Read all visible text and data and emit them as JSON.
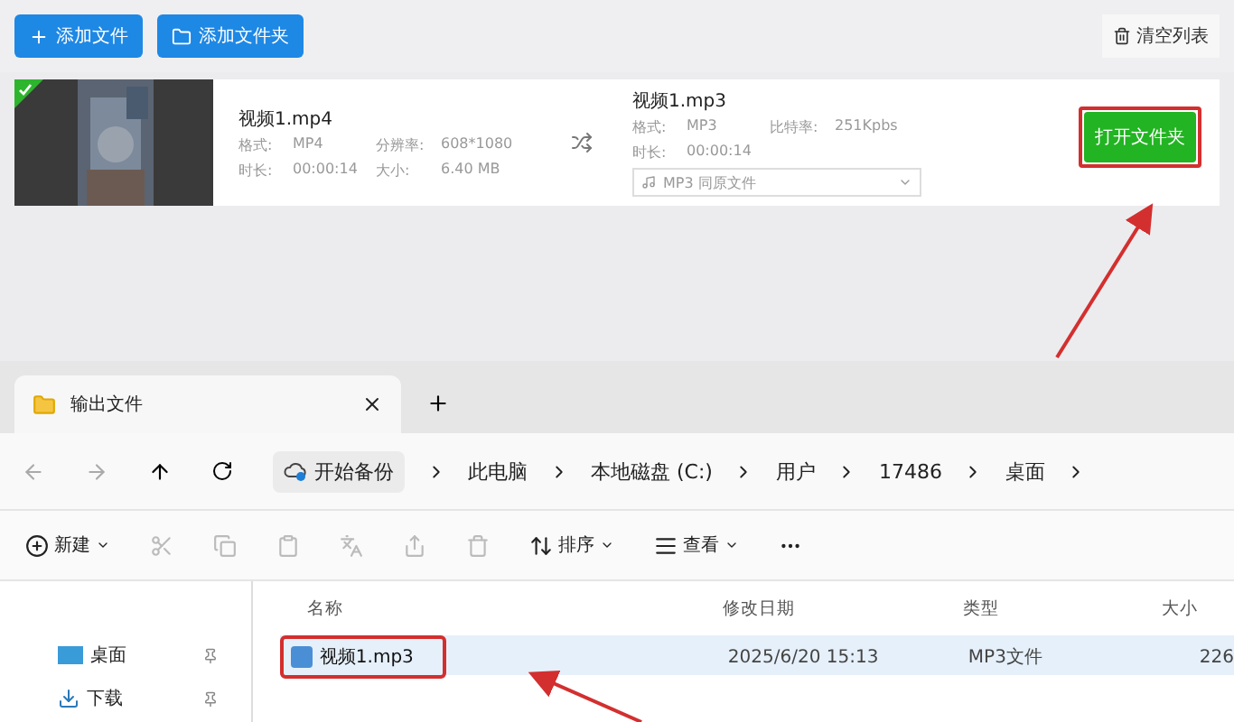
{
  "converter": {
    "buttons": [
      {
        "kind": "add",
        "label": "添加文件"
      },
      {
        "kind": "folder",
        "label": "添加文件夹"
      }
    ],
    "clear_button": "清空列表",
    "item": {
      "done": true,
      "source": {
        "name": "视频1.mp4",
        "fields": [
          [
            "格式:",
            "MP4"
          ],
          [
            "分辨率:",
            "608*1080"
          ],
          [
            "时长:",
            "00:00:14"
          ],
          [
            "大小:",
            "6.40 MB"
          ]
        ]
      },
      "output": {
        "name": "视频1.mp3",
        "fields": [
          [
            "格式:",
            "MP3"
          ],
          [
            "比特率:",
            "251Kpbs"
          ],
          [
            "时长:",
            "00:00:14"
          ]
        ],
        "format_select": [
          "MP3",
          "同原文件"
        ]
      },
      "open_folder_button": "打开文件夹"
    }
  },
  "explorer": {
    "tabs": [
      {
        "label": "输出文件",
        "selected": true
      }
    ],
    "breadcrumb": [
      "开始备份",
      "此电脑",
      "本地磁盘 (C:)",
      "用户",
      "17486",
      "桌面"
    ],
    "commands": [
      {
        "kind": "new",
        "label": "新建"
      },
      {
        "kind": "cut"
      },
      {
        "kind": "copy"
      },
      {
        "kind": "paste"
      },
      {
        "kind": "rename"
      },
      {
        "kind": "share"
      },
      {
        "kind": "delete"
      },
      {
        "kind": "sort",
        "label": "排序"
      },
      {
        "kind": "view",
        "label": "查看"
      },
      {
        "kind": "more"
      }
    ],
    "sidebar": [
      {
        "kind": "desktop",
        "label": "桌面"
      },
      {
        "kind": "download",
        "label": "下载"
      }
    ],
    "columns": [
      "名称",
      "修改日期",
      "类型",
      "大小"
    ],
    "rows": [
      {
        "name": "视频1.mp3",
        "modified": "2025/6/20 15:13",
        "type": "MP3文件",
        "size": "226",
        "selected": true
      }
    ]
  }
}
